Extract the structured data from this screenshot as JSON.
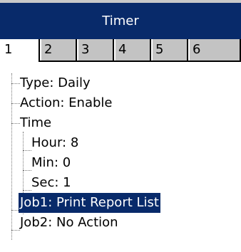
{
  "window": {
    "title": "Timer"
  },
  "tabs": [
    "1",
    "2",
    "3",
    "4",
    "5",
    "6"
  ],
  "tree": {
    "type": "Type: Daily",
    "action": "Action: Enable",
    "time": "Time",
    "hour": "Hour: 8",
    "min": "Min: 0",
    "sec": "Sec: 1",
    "job1": "Job1: Print Report List",
    "job2": "Job2: No Action"
  },
  "colors": {
    "titlebar": "#082a6a",
    "selection": "#082a6a",
    "tabbar": "#c3c3c3"
  }
}
